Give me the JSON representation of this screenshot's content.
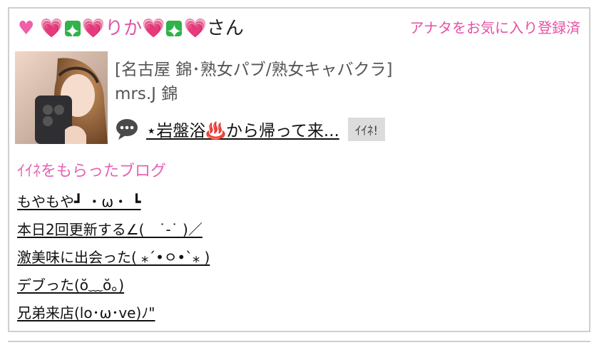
{
  "profile": {
    "name_prefix_heart": "♥",
    "name_suffix": "りか",
    "honorific": "さん"
  },
  "favorite_status": "アナタをお気に入り登録済",
  "shop": {
    "category": "[名古屋 錦･熟女パブ/熟女キャバクラ]",
    "name": "mrs.J 錦"
  },
  "latest_post": {
    "title": "⋆岩盤浴♨️から帰って来...",
    "iine_label": "ｲｲﾈ!"
  },
  "liked_blogs": {
    "heading": "ｲｲﾈをもらったブログ",
    "items": [
      "もやもや┛ ・ω・ ┗",
      "本日2回更新する∠(　˙-˙ )／",
      "激美味に出会った( ⁎ˊ•ㅇ•ˋ⁎ )",
      "デブった(ŏ﹏ŏ。)",
      "兄弟来店(lo･ω･ve)ﾉ\""
    ]
  }
}
